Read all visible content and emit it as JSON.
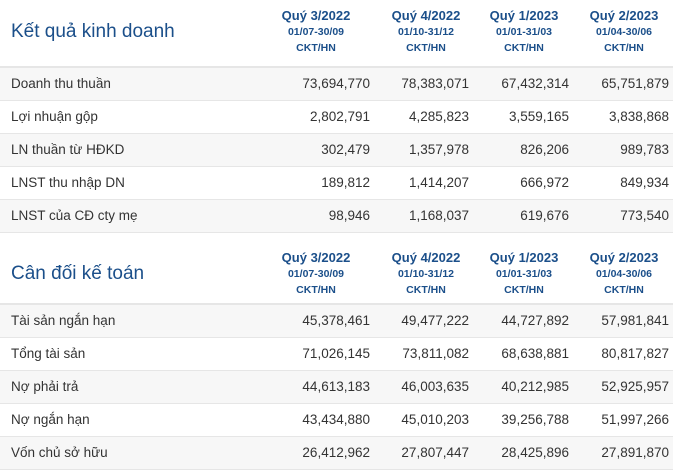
{
  "business": {
    "title": "Kết quả kinh doanh",
    "columns": [
      {
        "quarter": "Quý 3/2022",
        "range": "01/07-30/09",
        "unit": "CKT/HN"
      },
      {
        "quarter": "Quý 4/2022",
        "range": "01/10-31/12",
        "unit": "CKT/HN"
      },
      {
        "quarter": "Quý 1/2023",
        "range": "01/01-31/03",
        "unit": "CKT/HN"
      },
      {
        "quarter": "Quý 2/2023",
        "range": "01/04-30/06",
        "unit": "CKT/HN"
      }
    ],
    "rows": [
      {
        "label": "Doanh thu thuần",
        "values": [
          "73,694,770",
          "78,383,071",
          "67,432,314",
          "65,751,879"
        ]
      },
      {
        "label": "Lợi nhuận gộp",
        "values": [
          "2,802,791",
          "4,285,823",
          "3,559,165",
          "3,838,868"
        ]
      },
      {
        "label": "LN thuần từ HĐKD",
        "values": [
          "302,479",
          "1,357,978",
          "826,206",
          "989,783"
        ]
      },
      {
        "label": "LNST thu nhập DN",
        "values": [
          "189,812",
          "1,414,207",
          "666,972",
          "849,934"
        ]
      },
      {
        "label": "LNST của CĐ cty mẹ",
        "values": [
          "98,946",
          "1,168,037",
          "619,676",
          "773,540"
        ]
      }
    ]
  },
  "balance": {
    "title": "Cân đối kế toán",
    "columns": [
      {
        "quarter": "Quý 3/2022",
        "range": "01/07-30/09",
        "unit": "CKT/HN"
      },
      {
        "quarter": "Quý 4/2022",
        "range": "01/10-31/12",
        "unit": "CKT/HN"
      },
      {
        "quarter": "Quý 1/2023",
        "range": "01/01-31/03",
        "unit": "CKT/HN"
      },
      {
        "quarter": "Quý 2/2023",
        "range": "01/04-30/06",
        "unit": "CKT/HN"
      }
    ],
    "rows": [
      {
        "label": "Tài sản ngắn hạn",
        "values": [
          "45,378,461",
          "49,477,222",
          "44,727,892",
          "57,981,841"
        ]
      },
      {
        "label": "Tổng tài sản",
        "values": [
          "71,026,145",
          "73,811,082",
          "68,638,881",
          "80,817,827"
        ]
      },
      {
        "label": "Nợ phải trả",
        "values": [
          "44,613,183",
          "46,003,635",
          "40,212,985",
          "52,925,957"
        ]
      },
      {
        "label": "Nợ ngắn hạn",
        "values": [
          "43,434,880",
          "45,010,203",
          "39,256,788",
          "51,997,266"
        ]
      },
      {
        "label": "Vốn chủ sở hữu",
        "values": [
          "26,412,962",
          "27,807,447",
          "28,425,896",
          "27,891,870"
        ]
      }
    ]
  }
}
